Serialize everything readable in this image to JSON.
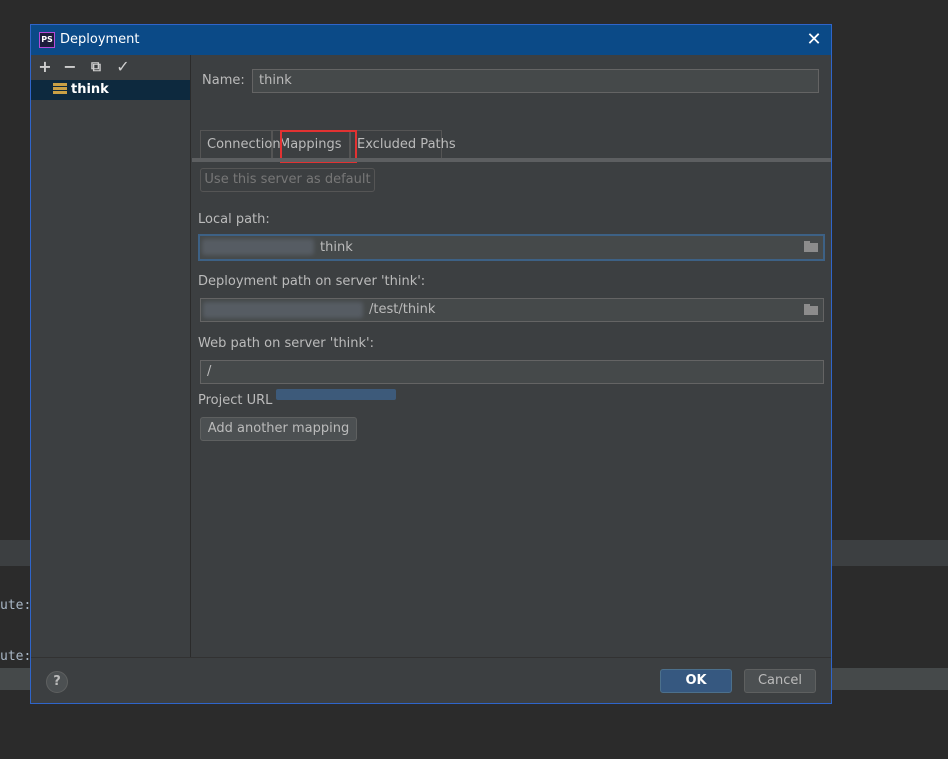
{
  "background": {
    "line1": "ute:",
    "line2": "ute:"
  },
  "dialog": {
    "title": "Deployment",
    "app_icon": "PS",
    "close_icon": "✕"
  },
  "left_toolbar": {
    "add": "+",
    "remove": "−",
    "copy": "⧉",
    "check": "✓"
  },
  "servers": [
    {
      "label": "think"
    }
  ],
  "name_field": {
    "label": "Name:",
    "value": "think"
  },
  "tabs": [
    {
      "label": "Connection"
    },
    {
      "label": "Mappings",
      "selected": true
    },
    {
      "label": "Excluded Paths"
    }
  ],
  "default_button": "Use this server as default",
  "local_path": {
    "label": "Local path:",
    "value_suffix": "think"
  },
  "deployment_path": {
    "label": "Deployment path on server 'think':",
    "value_suffix": "/test/think"
  },
  "web_path": {
    "label": "Web path on server 'think':",
    "value": "/"
  },
  "project_url": {
    "label": "Project URL"
  },
  "add_mapping_button": "Add another mapping",
  "footer": {
    "help": "?",
    "ok": "OK",
    "cancel": "Cancel"
  },
  "colors": {
    "titlebar": "#0b4a87",
    "highlight": "#e23232",
    "primary_button": "#365880",
    "selected_item": "#0d293e"
  }
}
